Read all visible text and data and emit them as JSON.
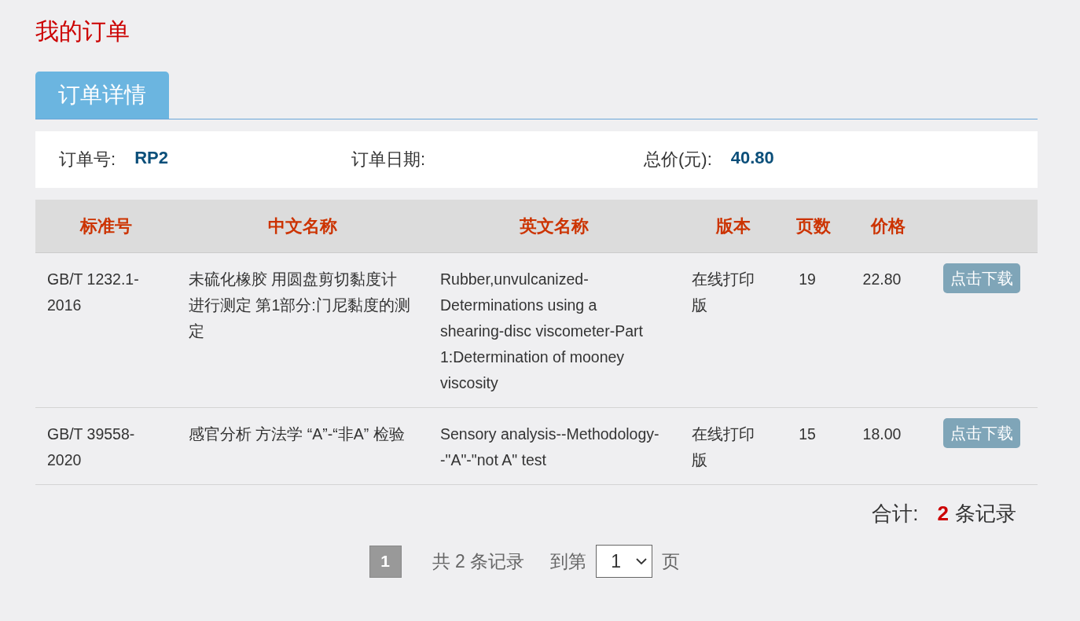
{
  "title": "我的订单",
  "tabs": [
    {
      "label": "订单详情",
      "selected": true
    }
  ],
  "order_info": [
    {
      "label": "订单号:",
      "value": "RP2"
    },
    {
      "label": "订单日期:"
    },
    {
      "label": "总价(元):",
      "value": "40.80"
    }
  ],
  "table": {
    "columns": [
      "标准号",
      "中文名称",
      "英文名称",
      "版本",
      "页数",
      "价格"
    ],
    "rows": [
      {
        "standard_no": "GB/T 1232.1-2016",
        "chinese_name": "未硫化橡胶 用圆盘剪切黏度计进行测定 第1部分:门尼黏度的测定",
        "english_name": "Rubber,unvulcanized-Determinations using a shearing-disc viscometer-Part 1:Determination of mooney viscosity",
        "edition": "在线打印版",
        "pages": "19",
        "price": "22.80",
        "action": "点击下载"
      },
      {
        "standard_no": "GB/T 39558-2020",
        "chinese_name": "感官分析 方法学 “A”-“非A” 检验",
        "english_name": "Sensory analysis--Methodology--\"A\"-\"not A\" test",
        "edition": "在线打印版",
        "pages": "15",
        "price": "18.00",
        "action": "点击下载"
      }
    ]
  },
  "total": {
    "label": "合计:",
    "count": "2",
    "suffix": "条记录"
  },
  "pagination": {
    "pages": [
      {
        "label": "1",
        "selected": true
      }
    ],
    "summary": "共 2 条记录",
    "goto_label": "到第",
    "page_select": "1",
    "page_suffix": "页"
  }
}
